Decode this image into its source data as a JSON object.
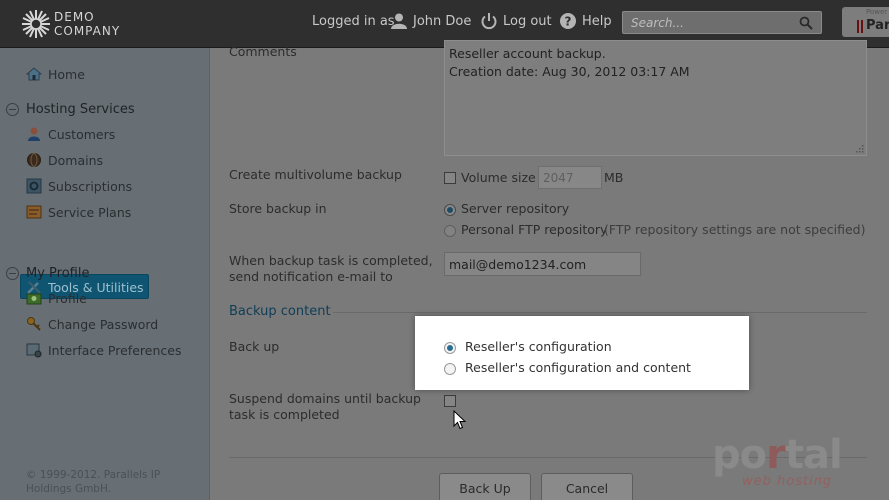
{
  "header": {
    "logo_line1": "DEMO",
    "logo_line2": "COMPANY",
    "logged_in_as": "Logged in as",
    "user_name": "John Doe",
    "logout": "Log out",
    "help": "Help",
    "search_placeholder": "Search...",
    "parallels_powered": "Power",
    "parallels_text": "Par"
  },
  "sidebar": {
    "home": "Home",
    "groups": [
      {
        "label": "Hosting Services",
        "items": [
          "Customers",
          "Domains",
          "Subscriptions",
          "Service Plans",
          "Tools & Utilities"
        ]
      },
      {
        "label": "My Profile",
        "items": [
          "Profile",
          "Change Password",
          "Interface Preferences"
        ]
      }
    ],
    "active_item": "Tools & Utilities",
    "copyright": "© 1999-2012. Parallels IP Holdings GmbH."
  },
  "form": {
    "comments_label": "Comments",
    "comments_line1": "Reseller account  backup.",
    "comments_line2": "Creation date: Aug 30, 2012 03:17 AM",
    "multivolume_label": "Create multivolume backup",
    "volume_size_label": "Volume size",
    "volume_size_value": "2047",
    "volume_unit": "MB",
    "store_label": "Store backup in",
    "store_options": [
      "Server repository",
      "Personal FTP repository"
    ],
    "store_selected": "Server repository",
    "ftp_note": "(FTP repository settings are not specified)",
    "notify_label_line1": "When backup task is completed,",
    "notify_label_line2": "send notification e-mail to",
    "notify_email": "mail@demo1234.com",
    "section_title": "Backup content",
    "backup_label": "Back up",
    "backup_options": [
      "Reseller's configuration",
      "Reseller's configuration and content"
    ],
    "backup_selected": "Reseller's configuration",
    "suspend_label_line1": "Suspend domains until backup",
    "suspend_label_line2": "task is completed",
    "back_up_button": "Back Up",
    "cancel_button": "Cancel"
  },
  "watermark": {
    "line1_a": "po",
    "line1_b": "r",
    "line1_c": "tal",
    "line2": "web hosting"
  }
}
